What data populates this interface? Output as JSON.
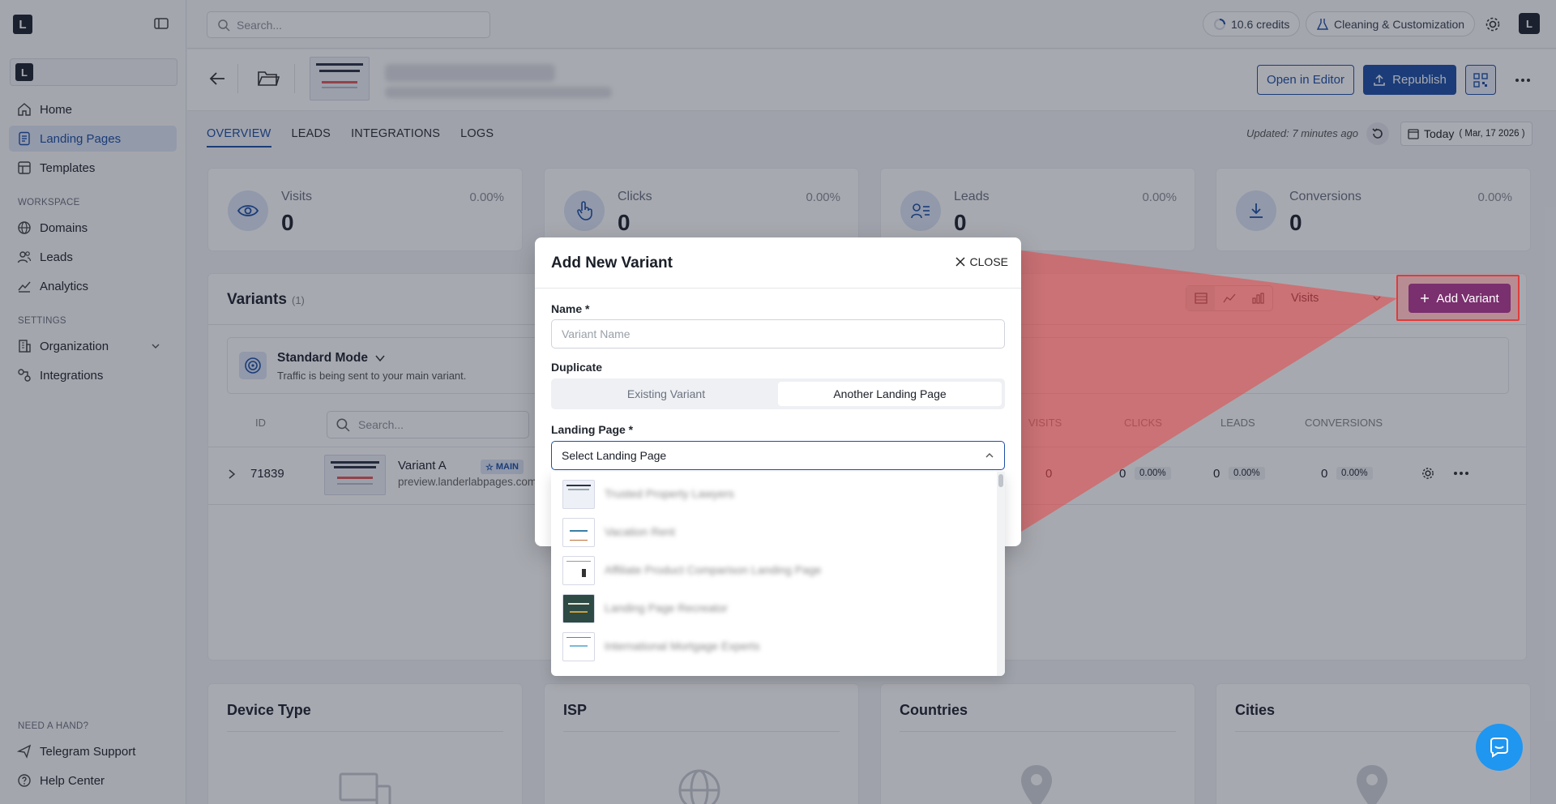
{
  "sidebar": {
    "nav": [
      {
        "label": "Home",
        "icon": "home-icon",
        "active": false
      },
      {
        "label": "Landing Pages",
        "icon": "landing-pages-icon",
        "active": true
      },
      {
        "label": "Templates",
        "icon": "templates-icon",
        "active": false
      }
    ],
    "workspace_heading": "WORKSPACE",
    "workspace_nav": [
      {
        "label": "Domains",
        "icon": "globe-icon"
      },
      {
        "label": "Leads",
        "icon": "users-icon"
      },
      {
        "label": "Analytics",
        "icon": "chart-icon"
      }
    ],
    "settings_heading": "SETTINGS",
    "settings_nav": [
      {
        "label": "Organization",
        "icon": "building-icon"
      },
      {
        "label": "Integrations",
        "icon": "integrations-icon"
      }
    ],
    "help_heading": "NEED A HAND?",
    "help_nav": [
      {
        "label": "Telegram Support",
        "icon": "send-icon"
      },
      {
        "label": "Help Center",
        "icon": "help-icon"
      }
    ]
  },
  "topbar": {
    "search_placeholder": "Search...",
    "credits": "10.6 credits",
    "mode": "Cleaning & Customization"
  },
  "page_header": {
    "open_editor": "Open in Editor",
    "republish": "Republish"
  },
  "tabs": [
    "OVERVIEW",
    "LEADS",
    "INTEGRATIONS",
    "LOGS"
  ],
  "updated": "Updated: 7 minutes ago",
  "date": {
    "label": "Today",
    "detail": "( Mar, 17 2026 )"
  },
  "stats": [
    {
      "label": "Visits",
      "value": "0",
      "pct": "0.00%"
    },
    {
      "label": "Clicks",
      "value": "0",
      "pct": "0.00%"
    },
    {
      "label": "Leads",
      "value": "0",
      "pct": "0.00%"
    },
    {
      "label": "Conversions",
      "value": "0",
      "pct": "0.00%"
    }
  ],
  "variants": {
    "title": "Variants",
    "count": "(1)",
    "metric_select": "Visits",
    "add_label": "Add Variant",
    "mode_title": "Standard Mode",
    "mode_desc": "Traffic is being sent to your main variant.",
    "search_placeholder": "Search...",
    "columns": {
      "id": "ID",
      "visits": "VISITS",
      "clicks": "CLICKS",
      "leads": "LEADS",
      "conversions": "CONVERSIONS"
    },
    "row": {
      "id": "71839",
      "name": "Variant A",
      "badge": "MAIN",
      "url": "preview.landerlabpages.com",
      "visits": "0",
      "clicks": "0",
      "clicks_pct": "0.00%",
      "leads": "0",
      "leads_pct": "0.00%",
      "conversions": "0",
      "conversions_pct": "0.00%"
    }
  },
  "bottom_cards": [
    "Device Type",
    "ISP",
    "Countries",
    "Cities"
  ],
  "modal": {
    "title": "Add New Variant",
    "close": "CLOSE",
    "name_label": "Name *",
    "name_placeholder": "Variant Name",
    "duplicate_label": "Duplicate",
    "dup_options": [
      "Existing Variant",
      "Another Landing Page"
    ],
    "landing_label": "Landing Page *",
    "landing_select": "Select Landing Page",
    "dropdown_items": [
      "Trusted Property Lawyers",
      "Vacation Rent",
      "Affiliate Product Comparison Landing Page",
      "Landing Page Recreator",
      "International Mortgage Experts"
    ]
  },
  "colors": {
    "primary": "#1d4fa5",
    "add_variant": "#7a2f6e",
    "highlight": "#e03b3b"
  }
}
